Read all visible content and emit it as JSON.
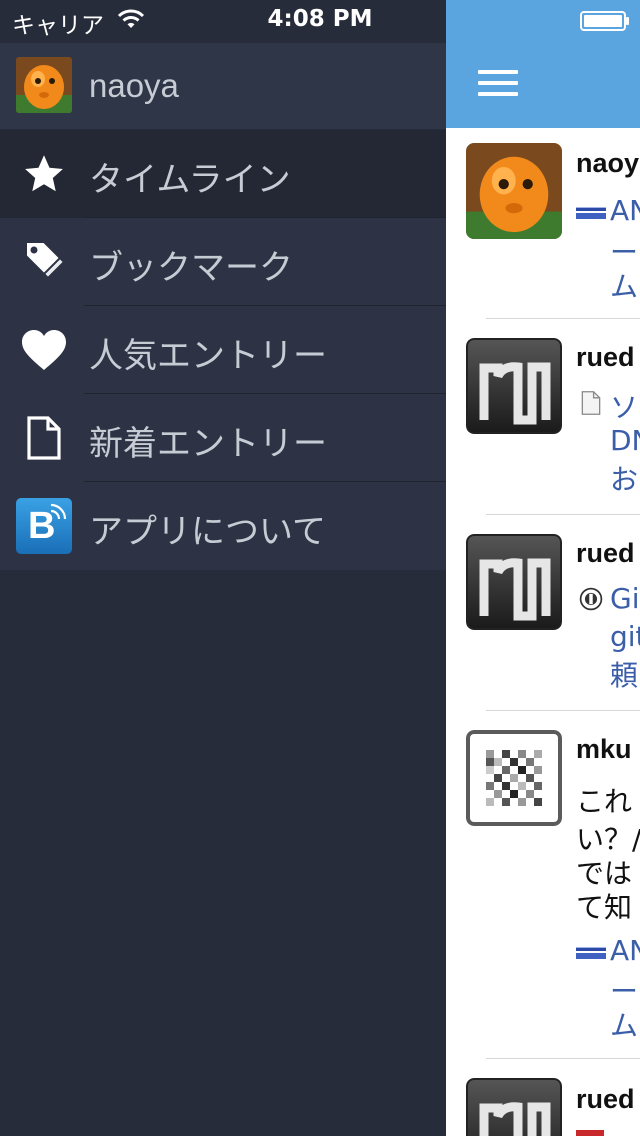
{
  "status": {
    "carrier": "キャリア",
    "time": "4:08 PM"
  },
  "menu": {
    "profile": {
      "name": "naoya"
    },
    "items": [
      {
        "label": "タイムライン",
        "icon": "star-icon"
      },
      {
        "label": "ブックマーク",
        "icon": "tag-icon"
      },
      {
        "label": "人気エントリー",
        "icon": "heart-icon"
      },
      {
        "label": "新着エントリー",
        "icon": "document-icon"
      },
      {
        "label": "アプリについて",
        "icon": "hatena-bookmark-icon"
      }
    ]
  },
  "feed": {
    "items": [
      {
        "user": "naoy",
        "lines": [
          "AN",
          "ー",
          "ム"
        ]
      },
      {
        "user": "rued",
        "lines": [
          "ソ",
          "DN",
          "お"
        ]
      },
      {
        "user": "rued",
        "lines": [
          "Git",
          "git",
          "頼"
        ]
      },
      {
        "user": "mku",
        "comment": [
          "これ",
          "い？/",
          "では",
          "て知"
        ],
        "lines": [
          "AN",
          "ー",
          "ム"
        ]
      },
      {
        "user": "rued"
      }
    ]
  },
  "colors": {
    "menu_bg": "#262c39",
    "header": "#5aa4df",
    "link": "#3b5ea8"
  }
}
